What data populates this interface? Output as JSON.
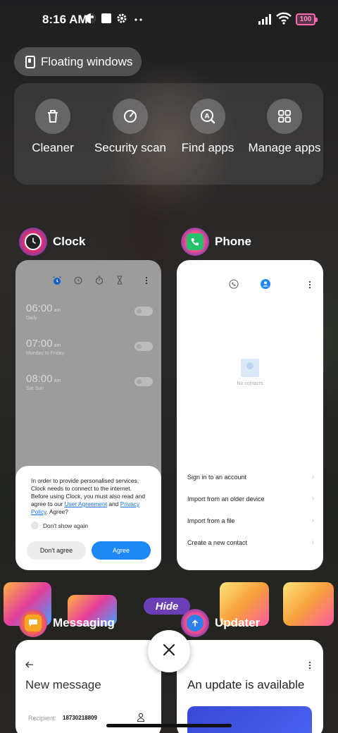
{
  "status_bar": {
    "time": "8:16 AM",
    "battery": "100",
    "icons": [
      "theme-icon",
      "notification-square-icon",
      "settings-icon",
      "more-dots-icon",
      "signal-icon",
      "wifi-icon",
      "battery-icon"
    ]
  },
  "floating_windows": {
    "label": "Floating windows",
    "icon": "floating-window-icon"
  },
  "tools": [
    {
      "label": "Cleaner",
      "icon": "trash-icon"
    },
    {
      "label": "Security scan",
      "icon": "security-scan-icon"
    },
    {
      "label": "Find apps",
      "icon": "find-apps-icon"
    },
    {
      "label": "Manage apps",
      "icon": "grid-icon"
    }
  ],
  "apps": {
    "clock": {
      "name": "Clock",
      "alarms": [
        {
          "time": "06:00",
          "ampm": "am",
          "repeat": "Daily"
        },
        {
          "time": "07:00",
          "ampm": "am",
          "repeat": "Monday to Friday"
        },
        {
          "time": "08:00",
          "ampm": "am",
          "repeat": "Sat Sun"
        }
      ],
      "consent": {
        "text_before": "In order to provide personalised services, Clock needs to connect to the internet. Before using Clock, you must also read and agree to our ",
        "link1": "User Agreement",
        "and": " and ",
        "link2": "Privacy Policy",
        "text_after": ". Agree?",
        "checkbox_label": "Don't show again",
        "decline": "Don't agree",
        "accept": "Agree"
      }
    },
    "phone": {
      "name": "Phone",
      "empty_text": "No contacts",
      "menu": [
        "Sign in to an account",
        "Import from an older device",
        "Import from a file",
        "Create a new contact"
      ]
    },
    "messaging": {
      "name": "Messaging",
      "title": "New message",
      "recipient_label": "Recipient:",
      "recipient_value": "18730218809"
    },
    "updater": {
      "name": "Updater",
      "title": "An update is available"
    }
  },
  "sticker_text": "Hide",
  "colors": {
    "accent": "#1e88f5",
    "battery": "#ff69b4"
  }
}
